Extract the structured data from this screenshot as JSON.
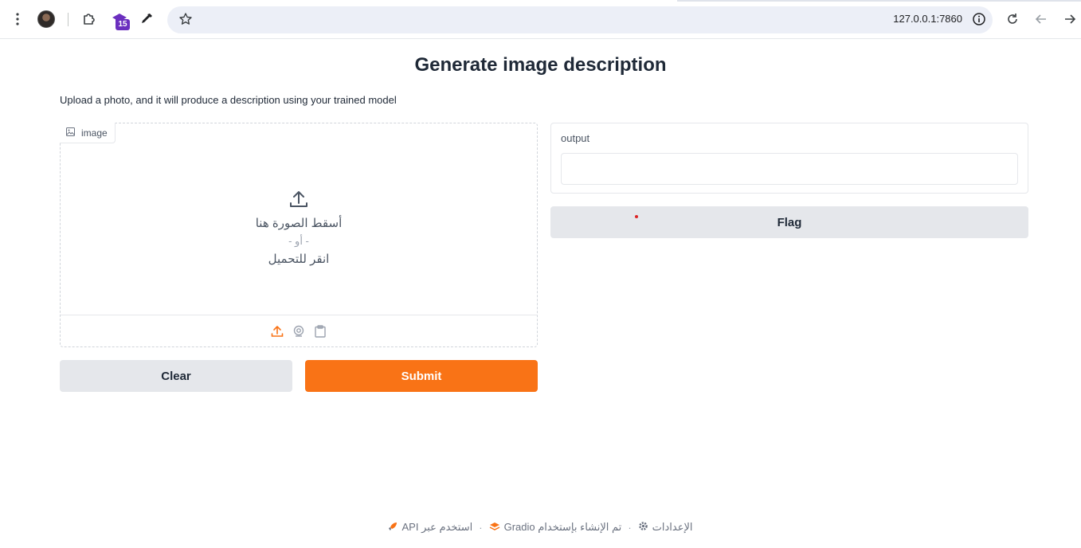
{
  "browser": {
    "url": "127.0.0.1:7860",
    "extension_badge": "15"
  },
  "page": {
    "title": "Generate image description",
    "description": "Upload a photo, and it will produce a description using your trained model"
  },
  "image_input": {
    "label": "image",
    "drop_text": "أسقط الصورة هنا",
    "or_text": "- أو -",
    "click_text": "انقر للتحميل"
  },
  "buttons": {
    "clear": "Clear",
    "submit": "Submit",
    "flag": "Flag"
  },
  "output": {
    "label": "output",
    "value": ""
  },
  "footer": {
    "api": "استخدم عبر API",
    "built_with": "تم الإنشاء بإستخدام Gradio",
    "settings": "الإعدادات"
  },
  "colors": {
    "accent": "#f97316",
    "secondary_button": "#e5e7eb"
  }
}
